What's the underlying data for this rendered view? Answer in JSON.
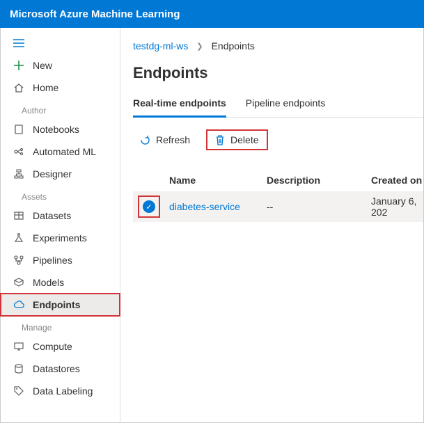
{
  "header": {
    "product": "Microsoft Azure Machine Learning"
  },
  "sidebar": {
    "new_label": "New",
    "home_label": "Home",
    "section_author": "Author",
    "notebooks_label": "Notebooks",
    "automl_label": "Automated ML",
    "designer_label": "Designer",
    "section_assets": "Assets",
    "datasets_label": "Datasets",
    "experiments_label": "Experiments",
    "pipelines_label": "Pipelines",
    "models_label": "Models",
    "endpoints_label": "Endpoints",
    "section_manage": "Manage",
    "compute_label": "Compute",
    "datastores_label": "Datastores",
    "datalabeling_label": "Data Labeling"
  },
  "breadcrumb": {
    "workspace": "testdg-ml-ws",
    "current": "Endpoints"
  },
  "page": {
    "title": "Endpoints"
  },
  "tabs": {
    "realtime": "Real-time endpoints",
    "pipeline": "Pipeline endpoints"
  },
  "toolbar": {
    "refresh": "Refresh",
    "delete": "Delete"
  },
  "table": {
    "head": {
      "name": "Name",
      "description": "Description",
      "created": "Created on"
    },
    "rows": [
      {
        "name": "diabetes-service",
        "description": "--",
        "created": "January 6, 202"
      }
    ]
  }
}
